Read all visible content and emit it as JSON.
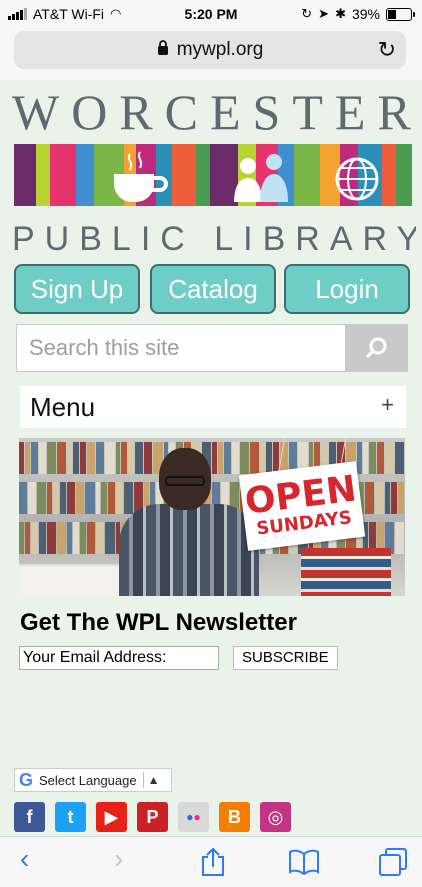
{
  "status_bar": {
    "carrier": "AT&T Wi-Fi",
    "time": "5:20 PM",
    "battery": "39%",
    "battery_level": 0.39
  },
  "browser": {
    "url": "mywpl.org"
  },
  "logo": {
    "line1": "WORCESTER",
    "line2": "PUBLIC LIBRARY",
    "book_colors": [
      "#6b2a6a",
      "#b8d432",
      "#e6336b",
      "#3f8fd1",
      "#7ab648",
      "#f2a32f",
      "#c12a7a",
      "#2c8fb8",
      "#ef5d3b",
      "#4a9b4f"
    ]
  },
  "nav_buttons": [
    {
      "label": "Sign Up"
    },
    {
      "label": "Catalog"
    },
    {
      "label": "Login"
    }
  ],
  "search": {
    "placeholder": "Search this site"
  },
  "menu": {
    "label": "Menu",
    "toggle": "+"
  },
  "banner": {
    "sign_line1": "OPEN",
    "sign_line2": "SUNDAYS"
  },
  "newsletter": {
    "title": "Get The WPL Newsletter",
    "email_value": "Your Email Address:",
    "subscribe_label": "SUBSCRIBE"
  },
  "translate": {
    "label": "Select Language"
  },
  "social": [
    {
      "name": "facebook-icon",
      "color": "#3b5998",
      "glyph": "f"
    },
    {
      "name": "twitter-icon",
      "color": "#1da1f2",
      "glyph": "t"
    },
    {
      "name": "youtube-icon",
      "color": "#e62117",
      "glyph": "▶"
    },
    {
      "name": "pinterest-icon",
      "color": "#cb2027",
      "glyph": "P"
    },
    {
      "name": "flickr-icon",
      "color": "#d9d9d9",
      "glyph": "••"
    },
    {
      "name": "blogger-icon",
      "color": "#f57d00",
      "glyph": "B"
    },
    {
      "name": "instagram-icon",
      "color": "#c13584",
      "glyph": "◎"
    }
  ],
  "colors": {
    "accent_teal": "#6ecdc6",
    "page_bg": "#eaf3ea",
    "ios_blue": "#2f7bf5",
    "sign_red": "#d6262e"
  }
}
